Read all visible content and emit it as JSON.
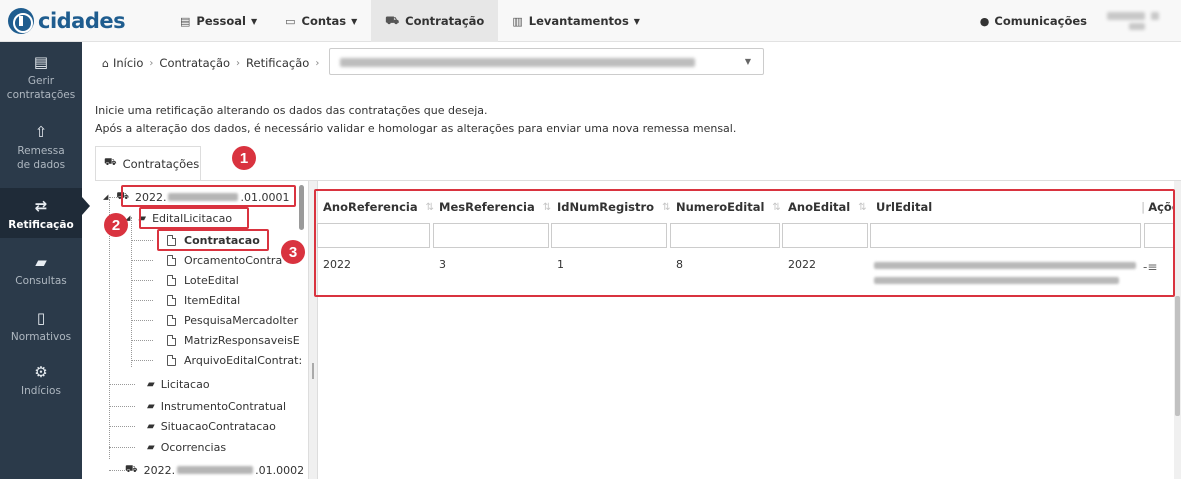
{
  "brand": {
    "logo_text": "cidades"
  },
  "nav": {
    "items": [
      {
        "label": "Pessoal",
        "icon": "id-card-icon",
        "dropdown": true
      },
      {
        "label": "Contas",
        "icon": "calendar-icon",
        "dropdown": true
      },
      {
        "label": "Contratação",
        "icon": "cart-icon",
        "dropdown": false,
        "active": true
      },
      {
        "label": "Levantamentos",
        "icon": "bar-chart-icon",
        "dropdown": true
      }
    ],
    "communications_label": "Comunicações"
  },
  "sidebar": {
    "items": [
      {
        "label": "Gerir contratações",
        "icon": "document-icon"
      },
      {
        "label": "Remessa de dados",
        "icon": "upload-icon"
      },
      {
        "label": "Retificação",
        "icon": "exchange-icon",
        "active": true
      },
      {
        "label": "Consultas",
        "icon": "book-icon"
      },
      {
        "label": "Normativos",
        "icon": "file-icon"
      },
      {
        "label": "Indícios",
        "icon": "cogs-icon"
      }
    ]
  },
  "breadcrumb": {
    "items": [
      "Início",
      "Contratação",
      "Retificação"
    ]
  },
  "intro": {
    "line1": "Inicie uma retificação alterando os dados das contratações que deseja.",
    "line2": "Após a alteração dos dados, é necessário validar e homologar as alterações para enviar uma nova remessa mensal."
  },
  "tab": {
    "label": "Contratações"
  },
  "tree": {
    "root1_prefix": "2022.",
    "root1_suffix": ".01.0001",
    "edital": "EditalLicitacao",
    "children": [
      "Contratacao",
      "OrcamentoContra",
      "LoteEdital",
      "ItemEdital",
      "PesquisaMercadoIter",
      "MatrizResponsaveisE",
      "ArquivoEditalContrat:"
    ],
    "siblings": [
      "Licitacao",
      "InstrumentoContratual",
      "SituacaoContratacao",
      "Ocorrencias"
    ],
    "root2_prefix": "2022.",
    "root2_suffix": ".01.0002"
  },
  "grid": {
    "columns": [
      "AnoReferencia",
      "MesReferencia",
      "IdNumRegistro",
      "NumeroEdital",
      "AnoEdital",
      "UrlEdital",
      "Ações"
    ],
    "rows": [
      {
        "AnoReferencia": "2022",
        "MesReferencia": "3",
        "IdNumRegistro": "1",
        "NumeroEdital": "8",
        "AnoEdital": "2022"
      }
    ]
  },
  "annotations": [
    "1",
    "2",
    "3"
  ],
  "colors": {
    "sidebar_bg": "#2b3a4a",
    "brand": "#1f5d8f",
    "highlight": "#d9333f"
  }
}
